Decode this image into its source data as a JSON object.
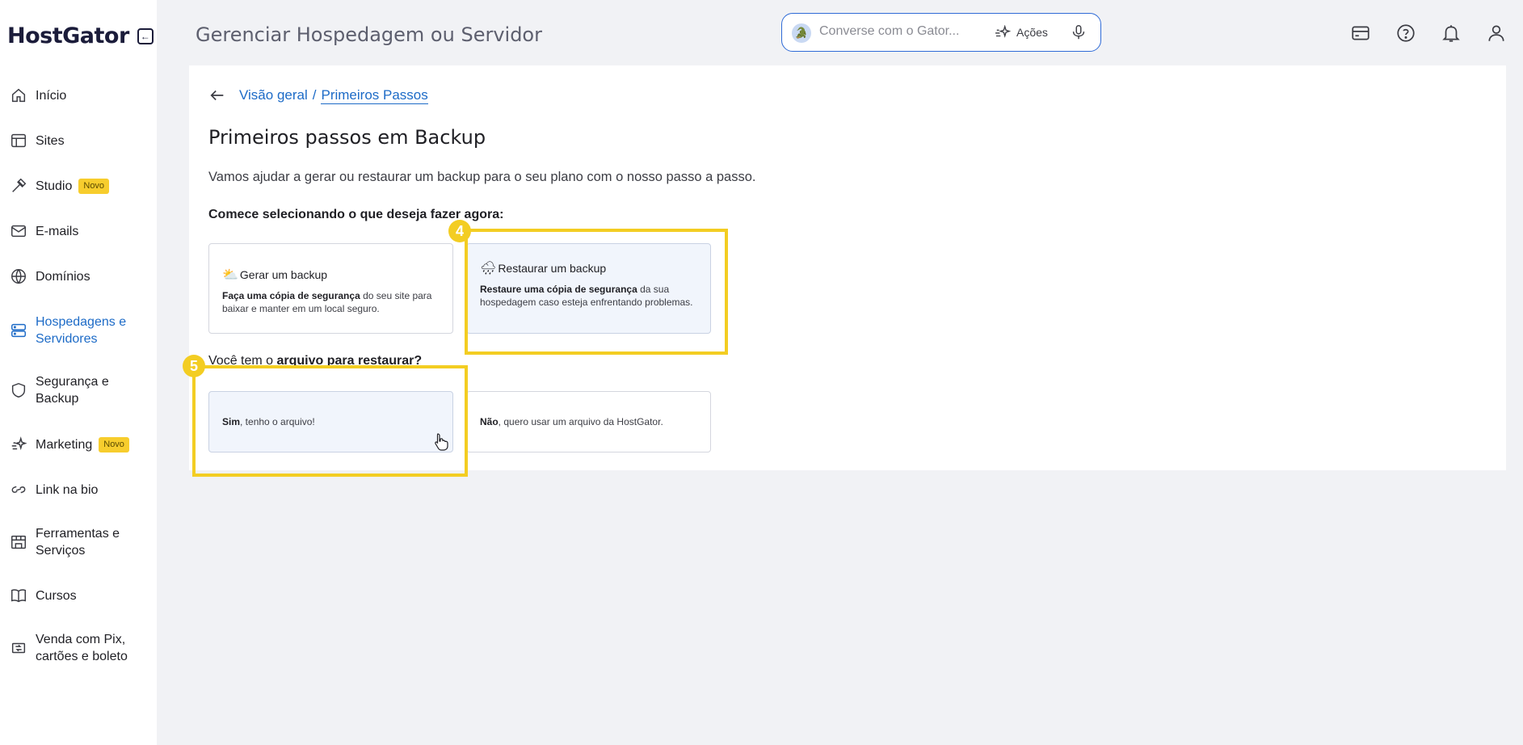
{
  "brand": {
    "name": "HostGator"
  },
  "sidebar": {
    "items": [
      {
        "label": "Início",
        "icon": "home-icon"
      },
      {
        "label": "Sites",
        "icon": "layout-icon"
      },
      {
        "label": "Studio",
        "icon": "studio-icon",
        "badge": "Novo"
      },
      {
        "label": "E-mails",
        "icon": "mail-icon"
      },
      {
        "label": "Domínios",
        "icon": "globe-icon"
      },
      {
        "label": "Hospedagens e\nServidores",
        "icon": "server-icon",
        "active": true
      },
      {
        "label": "Segurança e\nBackup",
        "icon": "shield-icon"
      },
      {
        "label": "Marketing",
        "icon": "sparkle-icon",
        "badge": "Novo"
      },
      {
        "label": "Link na bio",
        "icon": "link-icon"
      },
      {
        "label": "Ferramentas e\nServiços",
        "icon": "tools-icon"
      },
      {
        "label": "Cursos",
        "icon": "book-icon"
      },
      {
        "label": "Venda com Pix,\ncartões e boleto",
        "icon": "payment-icon"
      }
    ]
  },
  "header": {
    "title": "Gerenciar Hospedagem ou Servidor",
    "chat_placeholder": "Converse com o Gator...",
    "actions_label": "Ações"
  },
  "breadcrumb": {
    "parent": "Visão geral",
    "separator": "/",
    "current": "Primeiros Passos"
  },
  "main": {
    "title": "Primeiros passos em Backup",
    "subtitle": "Vamos ajudar a gerar ou restaurar um backup para o seu plano com o nosso passo a passo.",
    "section1_label": "Comece selecionando o que deseja fazer agora:",
    "card_generate": {
      "title": "Gerar um backup",
      "desc_bold": "Faça uma cópia de segurança",
      "desc_rest": " do seu site para baixar e manter em um local seguro."
    },
    "card_restore": {
      "title": "Restaurar um backup",
      "desc_bold": "Restaure uma cópia de segurança",
      "desc_rest": " da sua hospedagem caso esteja enfrentando problemas."
    },
    "section2_prefix": "Você tem o ",
    "section2_bold": "arquivo para restaurar?",
    "option_yes": {
      "bold": "Sim",
      "rest": ", tenho o arquivo!"
    },
    "option_no": {
      "bold": "Não",
      "rest": ", quero usar um arquivo da HostGator."
    }
  },
  "annotations": {
    "step4": "4",
    "step5": "5"
  },
  "colors": {
    "accent": "#1d6bc7",
    "highlight": "#f3cd22",
    "badge": "#f7cd2d"
  }
}
